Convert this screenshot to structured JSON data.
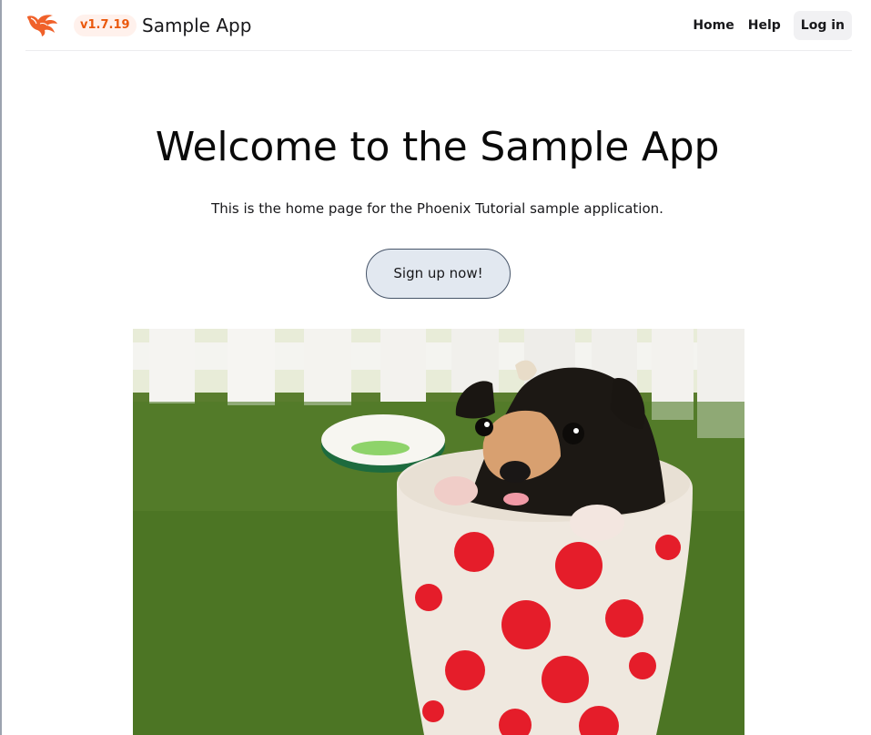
{
  "header": {
    "logo_icon": "phoenix-bird-logo-icon",
    "version": "v1.7.19",
    "brand": "Sample App",
    "nav": {
      "home": "Home",
      "help": "Help",
      "login": "Log in"
    }
  },
  "hero": {
    "title": "Welcome to the Sample App",
    "subtitle": "This is the home page for the Phoenix Tutorial sample application.",
    "signup_label": "Sign up now!"
  },
  "colors": {
    "accent": "#ea580c",
    "button_bg": "#e2e8f0",
    "button_border": "#475569"
  }
}
